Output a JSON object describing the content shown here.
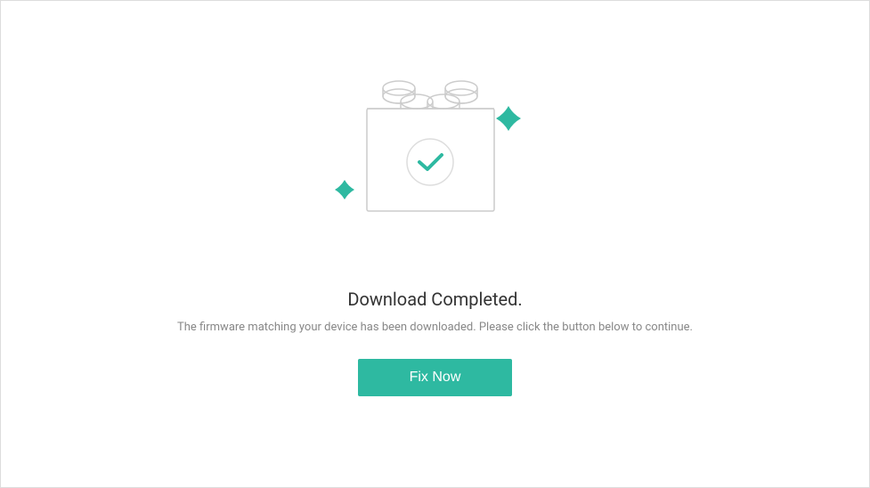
{
  "main": {
    "title": "Download Completed.",
    "subtitle": "The firmware matching your device has been downloaded. Please click the button below to continue.",
    "button_label": "Fix Now"
  },
  "colors": {
    "accent": "#2eb9a1"
  }
}
